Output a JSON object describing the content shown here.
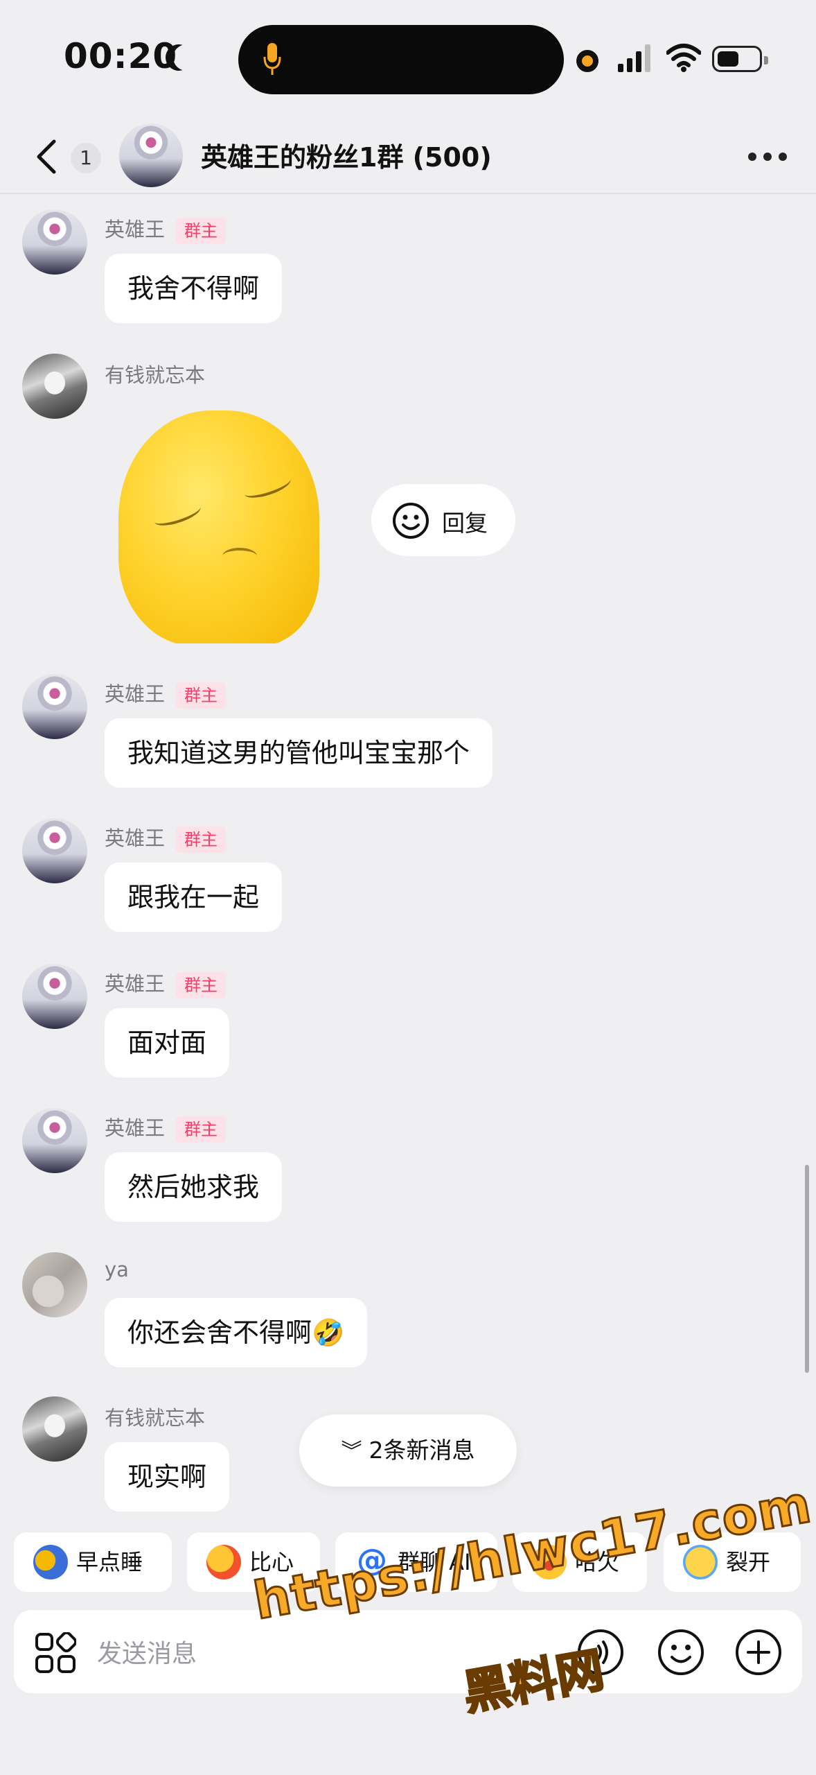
{
  "status_bar": {
    "time": "00:20"
  },
  "header": {
    "unread_count": "1",
    "title": "英雄王的粉丝1群 (500)"
  },
  "messages": [
    {
      "sender": "英雄王",
      "badge": "群主",
      "text": "我舍不得啊"
    },
    {
      "sender": "有钱就忘本",
      "type": "sticker",
      "reply_label": "回复"
    },
    {
      "sender": "英雄王",
      "badge": "群主",
      "text": "我知道这男的管他叫宝宝那个"
    },
    {
      "sender": "英雄王",
      "badge": "群主",
      "text": "跟我在一起"
    },
    {
      "sender": "英雄王",
      "badge": "群主",
      "text": "面对面"
    },
    {
      "sender": "英雄王",
      "badge": "群主",
      "text": "然后她求我"
    },
    {
      "sender": "ya",
      "text": "你还会舍不得啊🤣"
    },
    {
      "sender": "有钱就忘本",
      "text": "现实啊"
    }
  ],
  "new_messages_label": "2条新消息",
  "quick_replies": [
    {
      "label": "早点睡",
      "icon": "sleep-emoji-icon"
    },
    {
      "label": "比心",
      "icon": "heart-hand-emoji-icon"
    },
    {
      "label": "群聊 AI",
      "icon": "at-icon"
    },
    {
      "label": "哈欠",
      "icon": "yawn-emoji-icon"
    },
    {
      "label": "裂开",
      "icon": "crack-emoji-icon"
    }
  ],
  "input": {
    "placeholder": "发送消息"
  },
  "watermark": {
    "line1": "https://hlwc17.com",
    "line2": "黑料网"
  },
  "colors": {
    "badge_text": "#f0416a",
    "badge_bg": "#fde1e8",
    "at_blue": "#2b74f5",
    "watermark": "#f7a928"
  }
}
